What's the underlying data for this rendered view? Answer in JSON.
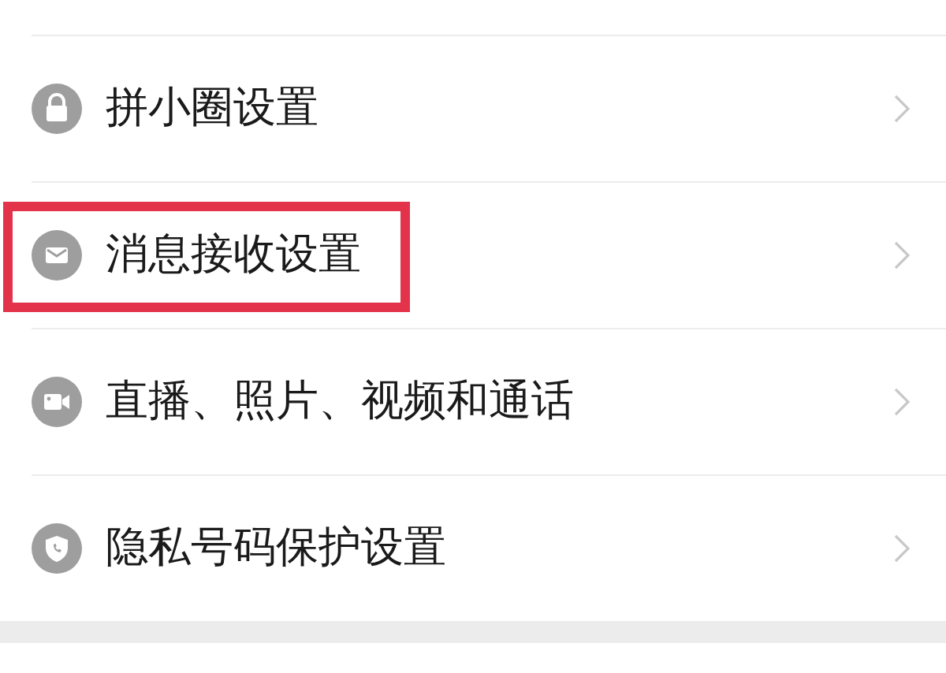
{
  "settings_items": [
    {
      "label": "拼小圈设置",
      "highlighted": false
    },
    {
      "label": "消息接收设置",
      "highlighted": true
    },
    {
      "label": "直播、照片、视频和通话",
      "highlighted": false
    },
    {
      "label": "隐私号码保护设置",
      "highlighted": false
    }
  ]
}
